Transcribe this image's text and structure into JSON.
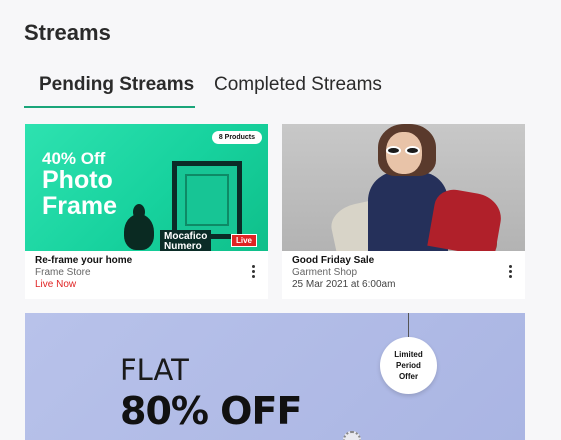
{
  "header": {
    "title": "Streams"
  },
  "tabs": [
    {
      "label": "Pending Streams",
      "active": true
    },
    {
      "label": "Completed Streams",
      "active": false
    }
  ],
  "colors": {
    "accent": "#1aa57a",
    "live": "#e02424"
  },
  "cards": [
    {
      "image": {
        "badge": "8 Products",
        "headline_1": "40% Off",
        "headline_2": "Photo",
        "headline_3": "Frame",
        "brand_1": "Mocafico",
        "brand_2": "Numero",
        "live_badge": "Live"
      },
      "title": "Re-frame your home",
      "store": "Frame Store",
      "status": "Live Now",
      "status_color": "#e02424"
    },
    {
      "title": "Good Friday Sale",
      "store": "Garment Shop",
      "status": "25 Mar 2021 at 6:00am",
      "status_color": "#444444"
    },
    {
      "image": {
        "line_1": "FLAT",
        "line_2": "80% OFF",
        "tag_1": "Limited",
        "tag_2": "Period",
        "tag_3": "Offer"
      }
    }
  ]
}
